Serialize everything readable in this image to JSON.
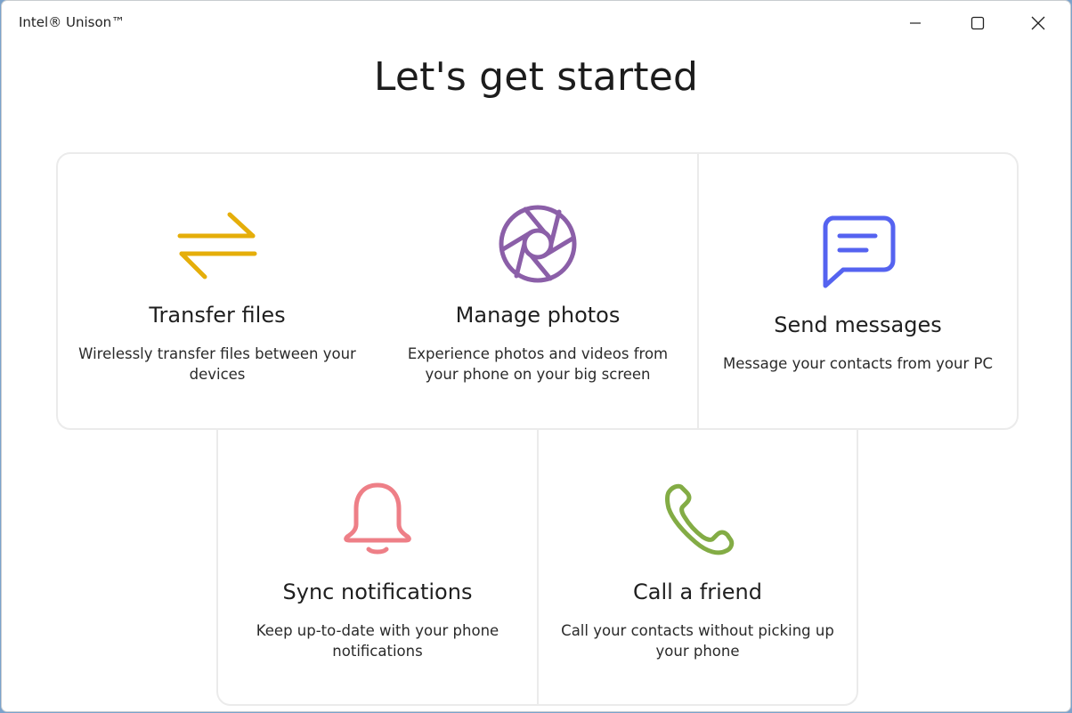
{
  "window": {
    "title": "Intel® Unison™"
  },
  "page": {
    "title": "Let's get started"
  },
  "cards": [
    {
      "id": "transfer",
      "icon": "transfer-arrows-icon",
      "color": "#E5AE0A",
      "title": "Transfer files",
      "description": "Wirelessly transfer files between your devices"
    },
    {
      "id": "photos",
      "icon": "camera-aperture-icon",
      "color": "#8B5FA8",
      "title": "Manage photos",
      "description": "Experience photos and videos from your phone on your big screen"
    },
    {
      "id": "messages",
      "icon": "chat-bubble-icon",
      "color": "#5563F0",
      "title": "Send messages",
      "description": "Message your contacts from your PC"
    },
    {
      "id": "notify",
      "icon": "bell-icon",
      "color": "#EE7F87",
      "title": "Sync notifications",
      "description": "Keep up-to-date with your phone notifications"
    },
    {
      "id": "call",
      "icon": "phone-icon",
      "color": "#83AC45",
      "title": "Call a friend",
      "description": "Call your contacts without picking up your phone"
    }
  ]
}
